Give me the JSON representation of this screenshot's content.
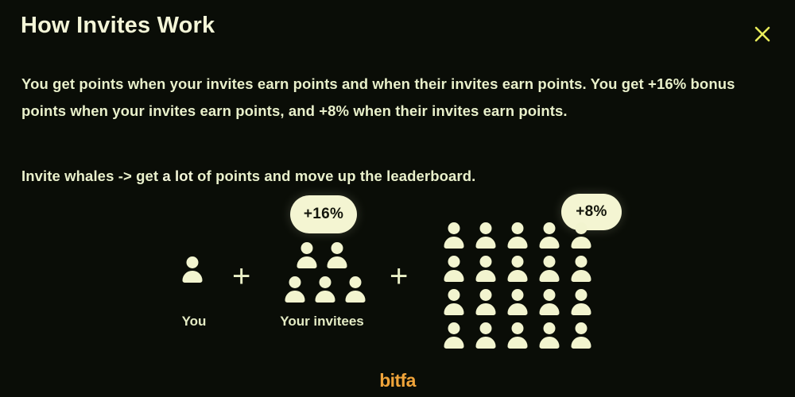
{
  "modal": {
    "title": "How Invites Work",
    "close_icon": "close-x-icon",
    "paragraphs": {
      "main": "You get points when your invites earn points and when their invites earn points. You get +16% bonus points when your invites earn points, and +8% when their invites earn points.",
      "sub_pre": "Invite whales -> get ",
      "sub_strong": "a lot",
      "sub_post": " of points and move up the leaderboard."
    }
  },
  "diagram": {
    "you": {
      "caption": "You",
      "count": 1
    },
    "invitees": {
      "caption": "Your invitees",
      "badge": "+16%",
      "row_1_count": 2,
      "row_2_count": 3
    },
    "second_degree": {
      "badge": "+8%",
      "columns": 5,
      "rows": 4,
      "count": 20
    },
    "operator_1": "+",
    "operator_2": "+",
    "person_icon": "person-icon"
  },
  "footer": {
    "logo_text": "itfa",
    "logo_prefix": "b"
  },
  "colors": {
    "background": "#0a0d07",
    "text": "#e9f0cb",
    "title": "#f4f6d8",
    "badge_bg": "#f4f5d2",
    "badge_text": "#14160c",
    "icon": "#f2f4cf",
    "close": "#e8ec5a",
    "logo": "#f0a43a"
  }
}
